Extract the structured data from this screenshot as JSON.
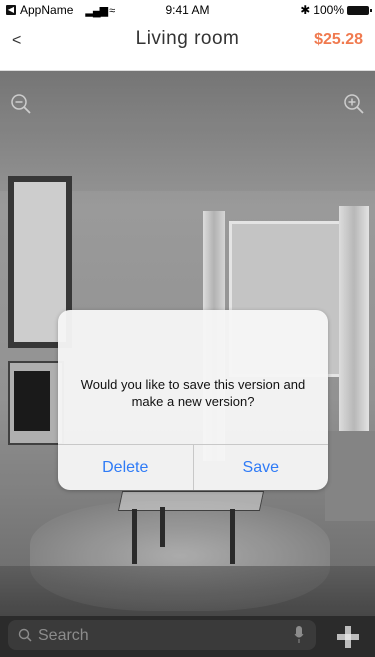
{
  "status_bar": {
    "app_back_label": "AppName",
    "time": "9:41 AM",
    "battery": "100%"
  },
  "nav": {
    "back": "<",
    "title": "Living room",
    "price": "$25.28"
  },
  "alert": {
    "message": "Would you like to save this version and make a new version?",
    "delete_label": "Delete",
    "save_label": "Save"
  },
  "search": {
    "placeholder": "Search"
  },
  "icons": {
    "zoom_out": "zoom-out-icon",
    "zoom_in": "zoom-in-icon",
    "search": "search-icon",
    "mic": "microphone-icon",
    "move": "move-icon"
  },
  "colors": {
    "price": "#f07a4f",
    "alert_button": "#2f7bf6",
    "bottom_bar": "#2b2b2b"
  }
}
